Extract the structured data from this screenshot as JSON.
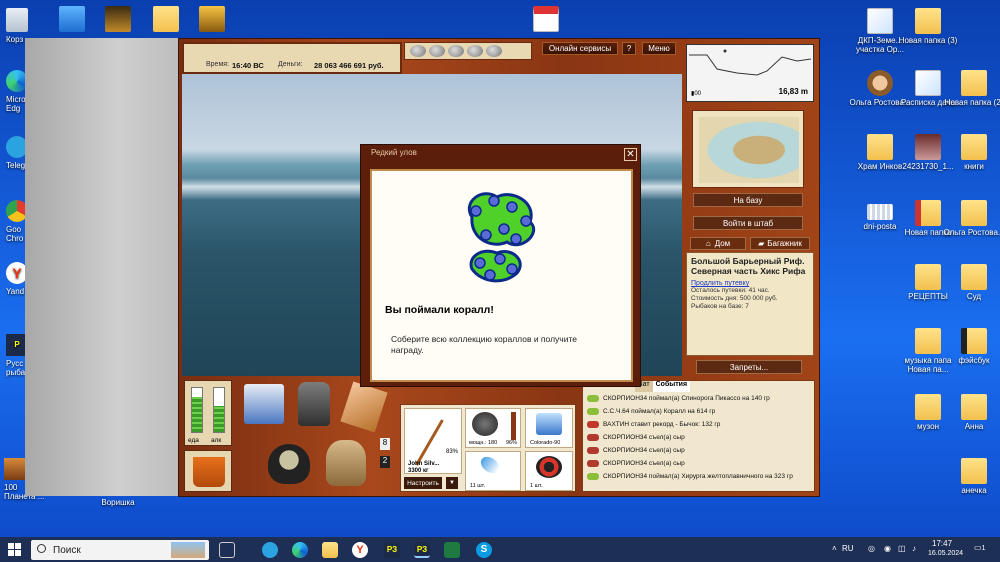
{
  "desktop": {
    "left_icons": [
      {
        "label": "Корз"
      },
      {
        "label": "Micro Edg"
      },
      {
        "label": "Teleg"
      },
      {
        "label": "Goo Chro"
      },
      {
        "label": "Yand"
      },
      {
        "label": "Русс рыба"
      },
      {
        "label": "100 Планета ..."
      }
    ],
    "top_icons": [
      {
        "label": "Воришка"
      }
    ],
    "right_icons": [
      {
        "label": "ДКП-Земе... участка Ор..."
      },
      {
        "label": "Новая папка (3)"
      },
      {
        "label": "Ольга Ростова..."
      },
      {
        "label": "Расписка дача"
      },
      {
        "label": "Новая папка (2)"
      },
      {
        "label": "Храм Инков"
      },
      {
        "label": "24231730_1..."
      },
      {
        "label": "книги"
      },
      {
        "label": "dni-posta"
      },
      {
        "label": "Новая папка"
      },
      {
        "label": "Ольга Ростова..."
      },
      {
        "label": "РЕЦЕПТЫ"
      },
      {
        "label": "Суд"
      },
      {
        "label": "музыка папа Новая па..."
      },
      {
        "label": "фэйсбук"
      },
      {
        "label": "музон"
      },
      {
        "label": "Анна"
      },
      {
        "label": "анечка"
      }
    ]
  },
  "game": {
    "top": {
      "time_label": "Время:",
      "time_value": "16:40 ВС",
      "money_label": "Деньги:",
      "money_value": "28 063 466 691 руб.",
      "online_button": "Онлайн сервисы",
      "help_button": "?",
      "menu_button": "Меню"
    },
    "depth": {
      "value": "16,83 m",
      "battery": "00"
    },
    "right_panel": {
      "base_button": "На базу",
      "hq_button": "Войти в штаб",
      "home_tab": "Дом",
      "trunk_tab": "Багажник",
      "location_title": "Большой Барьерный Риф. Северная часть Хикс Рифа",
      "extend_link": "Продлить путевку",
      "remaining": "Осталось путевки: 41 час.",
      "cost": "Стоимость дня: 500 000 руб.",
      "fishers": "Рыбаков на базе: 7",
      "bans_button": "Запреты..."
    },
    "gauge": {
      "left_label": "еда",
      "right_label": "алк"
    },
    "inventory_counts": {
      "a": "8",
      "b": "2"
    },
    "tackle": {
      "rod_name": "John Silv...",
      "rod_weight": "3300 кг",
      "rod_pct": "83%",
      "reel_stat1": "мощн.: 180",
      "reel_stat2": "96%",
      "line_name": "Colorado-90",
      "float_count": "11 шт.",
      "bait_count": "1 шт.",
      "configure_button": "Настроить",
      "configure_arrow": "▼"
    },
    "events": {
      "tab_chat": "Чат",
      "tab_events": "События",
      "items": [
        {
          "text": "СКОРПИОН34 поймал(а) Спинорога Пикассо на 140 гр",
          "color": "#8bbf3a"
        },
        {
          "text": "С.С.Ч.64 поймал(а) Коралл на 614 гр",
          "color": "#8bbf3a"
        },
        {
          "text": "ВАХТИН ставит рекорд - Бычок: 132 гр",
          "color": "#c0392b"
        },
        {
          "text": "СКОРПИОН34 съел(а) сыр",
          "color": "#b03a2e"
        },
        {
          "text": "СКОРПИОН34 съел(а) сыр",
          "color": "#b03a2e"
        },
        {
          "text": "СКОРПИОН34 съел(а) сыр",
          "color": "#b03a2e"
        },
        {
          "text": "СКОРПИОН34 поймал(а) Хирурга желтоплавничного на 323 гр",
          "color": "#8bbf3a"
        }
      ]
    },
    "dialog": {
      "header": "Редкий улов",
      "close": "✕",
      "title": "Вы поймали коралл!",
      "text": "Соберите всю коллекцию кораллов и получите награду."
    }
  },
  "taskbar": {
    "search_placeholder": "Поиск",
    "lang": "RU",
    "time": "17:47",
    "date": "16.05.2024",
    "notif": "1"
  }
}
